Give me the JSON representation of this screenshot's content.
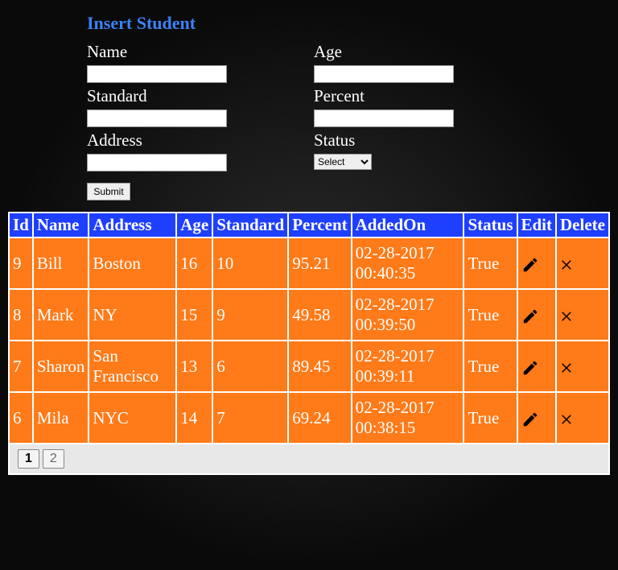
{
  "form": {
    "title": "Insert Student",
    "left": [
      {
        "label": "Name",
        "value": ""
      },
      {
        "label": "Standard",
        "value": ""
      },
      {
        "label": "Address",
        "value": ""
      }
    ],
    "right": [
      {
        "label": "Age",
        "value": ""
      },
      {
        "label": "Percent",
        "value": ""
      },
      {
        "label": "Status",
        "select": "Select"
      }
    ],
    "submit": "Submit"
  },
  "table": {
    "headers": [
      "Id",
      "Name",
      "Address",
      "Age",
      "Standard",
      "Percent",
      "AddedOn",
      "Status",
      "Edit",
      "Delete"
    ],
    "rows": [
      {
        "id": "9",
        "name": "Bill",
        "address": "Boston",
        "age": "16",
        "standard": "10",
        "percent": "95.21",
        "addedon": "02-28-2017 00:40:35",
        "status": "True"
      },
      {
        "id": "8",
        "name": "Mark",
        "address": "NY",
        "age": "15",
        "standard": "9",
        "percent": "49.58",
        "addedon": "02-28-2017 00:39:50",
        "status": "True"
      },
      {
        "id": "7",
        "name": "Sharon",
        "address": "San Francisco",
        "age": "13",
        "standard": "6",
        "percent": "89.45",
        "addedon": "02-28-2017 00:39:11",
        "status": "True"
      },
      {
        "id": "6",
        "name": "Mila",
        "address": "NYC",
        "age": "14",
        "standard": "7",
        "percent": "69.24",
        "addedon": "02-28-2017 00:38:15",
        "status": "True"
      }
    ]
  },
  "pagination": {
    "pages": [
      "1",
      "2"
    ],
    "active": "1"
  }
}
